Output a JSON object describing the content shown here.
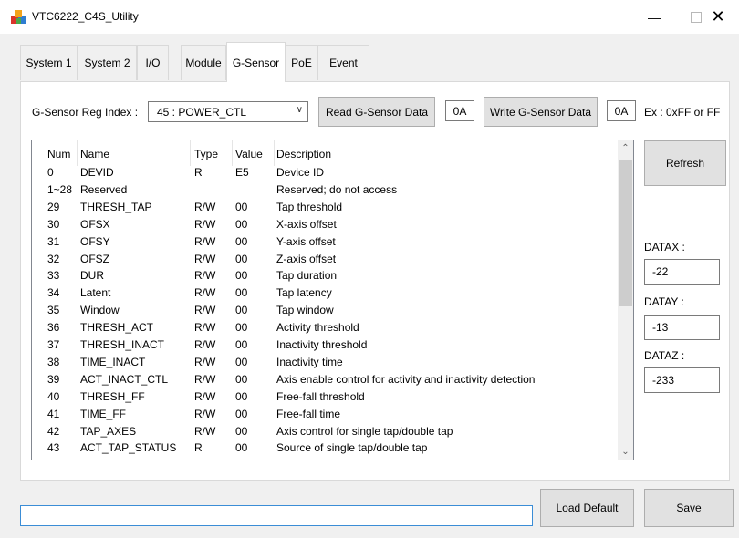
{
  "window": {
    "title": "VTC6222_C4S_Utility",
    "minimize": "—",
    "close": "✕"
  },
  "tabs": [
    {
      "label": "System 1",
      "active": false
    },
    {
      "label": "System 2",
      "active": false
    },
    {
      "label": "I/O",
      "active": false
    },
    {
      "label": "Module",
      "active": false
    },
    {
      "label": "G-Sensor",
      "active": true
    },
    {
      "label": "PoE",
      "active": false
    },
    {
      "label": "Event",
      "active": false
    }
  ],
  "gsensor": {
    "reg_index_label": "G-Sensor Reg Index :",
    "reg_index_value": "45 : POWER_CTL",
    "read_button": "Read G-Sensor Data",
    "read_value": "0A",
    "write_button": "Write G-Sensor Data",
    "write_value": "0A",
    "example_hint": "Ex : 0xFF or FF",
    "refresh_button": "Refresh",
    "datax_label": "DATAX :",
    "datax_value": "-22",
    "datay_label": "DATAY :",
    "datay_value": "-13",
    "dataz_label": "DATAZ :",
    "dataz_value": "-233"
  },
  "table": {
    "columns": [
      "Num",
      "Name",
      "Type",
      "Value",
      "Description"
    ]
  },
  "chart_data": {
    "type": "table",
    "columns": [
      "Num",
      "Name",
      "Type",
      "Value",
      "Description"
    ],
    "rows": [
      [
        "0",
        "DEVID",
        "R",
        "E5",
        "Device ID"
      ],
      [
        "1~28",
        "Reserved",
        "",
        "",
        "Reserved; do not access"
      ],
      [
        "29",
        "THRESH_TAP",
        "R/W",
        "00",
        "Tap threshold"
      ],
      [
        "30",
        "OFSX",
        "R/W",
        "00",
        "X-axis offset"
      ],
      [
        "31",
        "OFSY",
        "R/W",
        "00",
        "Y-axis offset"
      ],
      [
        "32",
        "OFSZ",
        "R/W",
        "00",
        "Z-axis offset"
      ],
      [
        "33",
        "DUR",
        "R/W",
        "00",
        "Tap duration"
      ],
      [
        "34",
        "Latent",
        "R/W",
        "00",
        "Tap latency"
      ],
      [
        "35",
        "Window",
        "R/W",
        "00",
        "Tap window"
      ],
      [
        "36",
        "THRESH_ACT",
        "R/W",
        "00",
        "Activity threshold"
      ],
      [
        "37",
        "THRESH_INACT",
        "R/W",
        "00",
        "Inactivity threshold"
      ],
      [
        "38",
        "TIME_INACT",
        "R/W",
        "00",
        "Inactivity time"
      ],
      [
        "39",
        "ACT_INACT_CTL",
        "R/W",
        "00",
        "Axis enable control for activity and inactivity detection"
      ],
      [
        "40",
        "THRESH_FF",
        "R/W",
        "00",
        "Free-fall threshold"
      ],
      [
        "41",
        "TIME_FF",
        "R/W",
        "00",
        "Free-fall time"
      ],
      [
        "42",
        "TAP_AXES",
        "R/W",
        "00",
        "Axis control for single tap/double tap"
      ],
      [
        "43",
        "ACT_TAP_STATUS",
        "R",
        "00",
        "Source of single tap/double tap"
      ]
    ]
  },
  "footer": {
    "status_text": "",
    "load_default_button": "Load Default",
    "save_button": "Save"
  }
}
